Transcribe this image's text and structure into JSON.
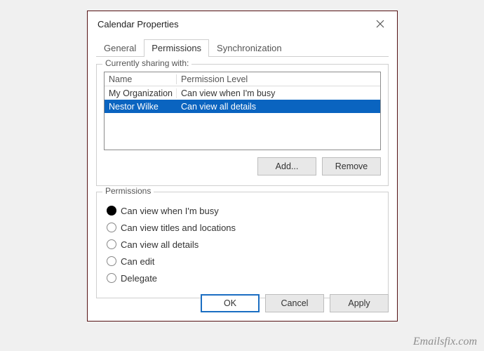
{
  "dialog": {
    "title": "Calendar Properties"
  },
  "tabs": {
    "general": "General",
    "permissions": "Permissions",
    "synchronization": "Synchronization"
  },
  "sharing": {
    "legend": "Currently sharing with:",
    "headers": {
      "name": "Name",
      "level": "Permission Level"
    },
    "rows": [
      {
        "name": "My Organization",
        "level": "Can view when I'm busy",
        "selected": false
      },
      {
        "name": "Nestor Wilke",
        "level": "Can view all details",
        "selected": true
      }
    ],
    "add_label": "Add...",
    "remove_label": "Remove"
  },
  "permissions": {
    "legend": "Permissions",
    "options": [
      {
        "label": "Can view when I'm busy",
        "selected": true
      },
      {
        "label": "Can view titles and locations",
        "selected": false
      },
      {
        "label": "Can view all details",
        "selected": false
      },
      {
        "label": "Can edit",
        "selected": false
      },
      {
        "label": "Delegate",
        "selected": false
      }
    ]
  },
  "footer": {
    "ok": "OK",
    "cancel": "Cancel",
    "apply": "Apply"
  },
  "watermark": "Emailsfix.com"
}
